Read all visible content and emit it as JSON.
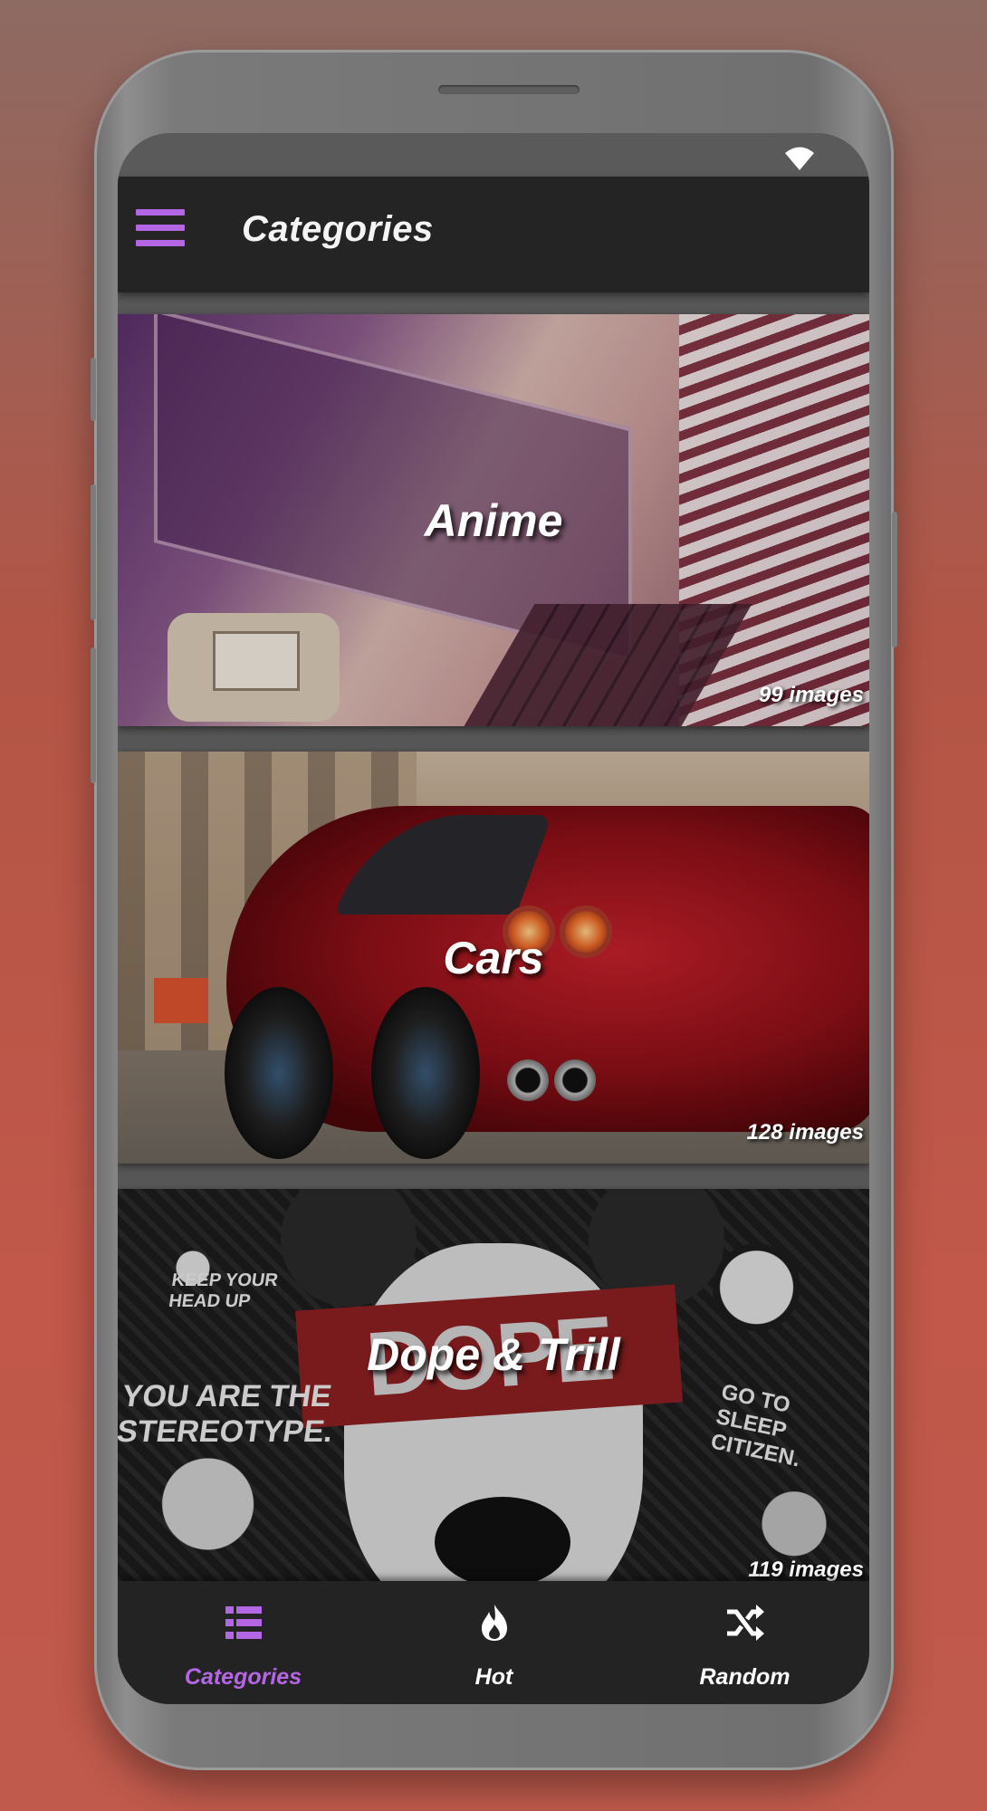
{
  "app_bar": {
    "title": "Categories"
  },
  "categories": [
    {
      "name": "Anime",
      "count": "99 images"
    },
    {
      "name": "Cars",
      "count": "128 images"
    },
    {
      "name": "Dope & Trill",
      "count": "119 images"
    }
  ],
  "bottom_nav": {
    "items": [
      {
        "label": "Categories",
        "icon": "list-icon",
        "active": true
      },
      {
        "label": "Hot",
        "icon": "flame-icon",
        "active": false
      },
      {
        "label": "Random",
        "icon": "shuffle-icon",
        "active": false
      }
    ]
  },
  "artwork_text": {
    "dope_banner": "DOPE"
  },
  "colors": {
    "accent": "#b566e4",
    "app_bar": "#242424",
    "nav_bar": "#232323",
    "background": "#c1584a"
  }
}
